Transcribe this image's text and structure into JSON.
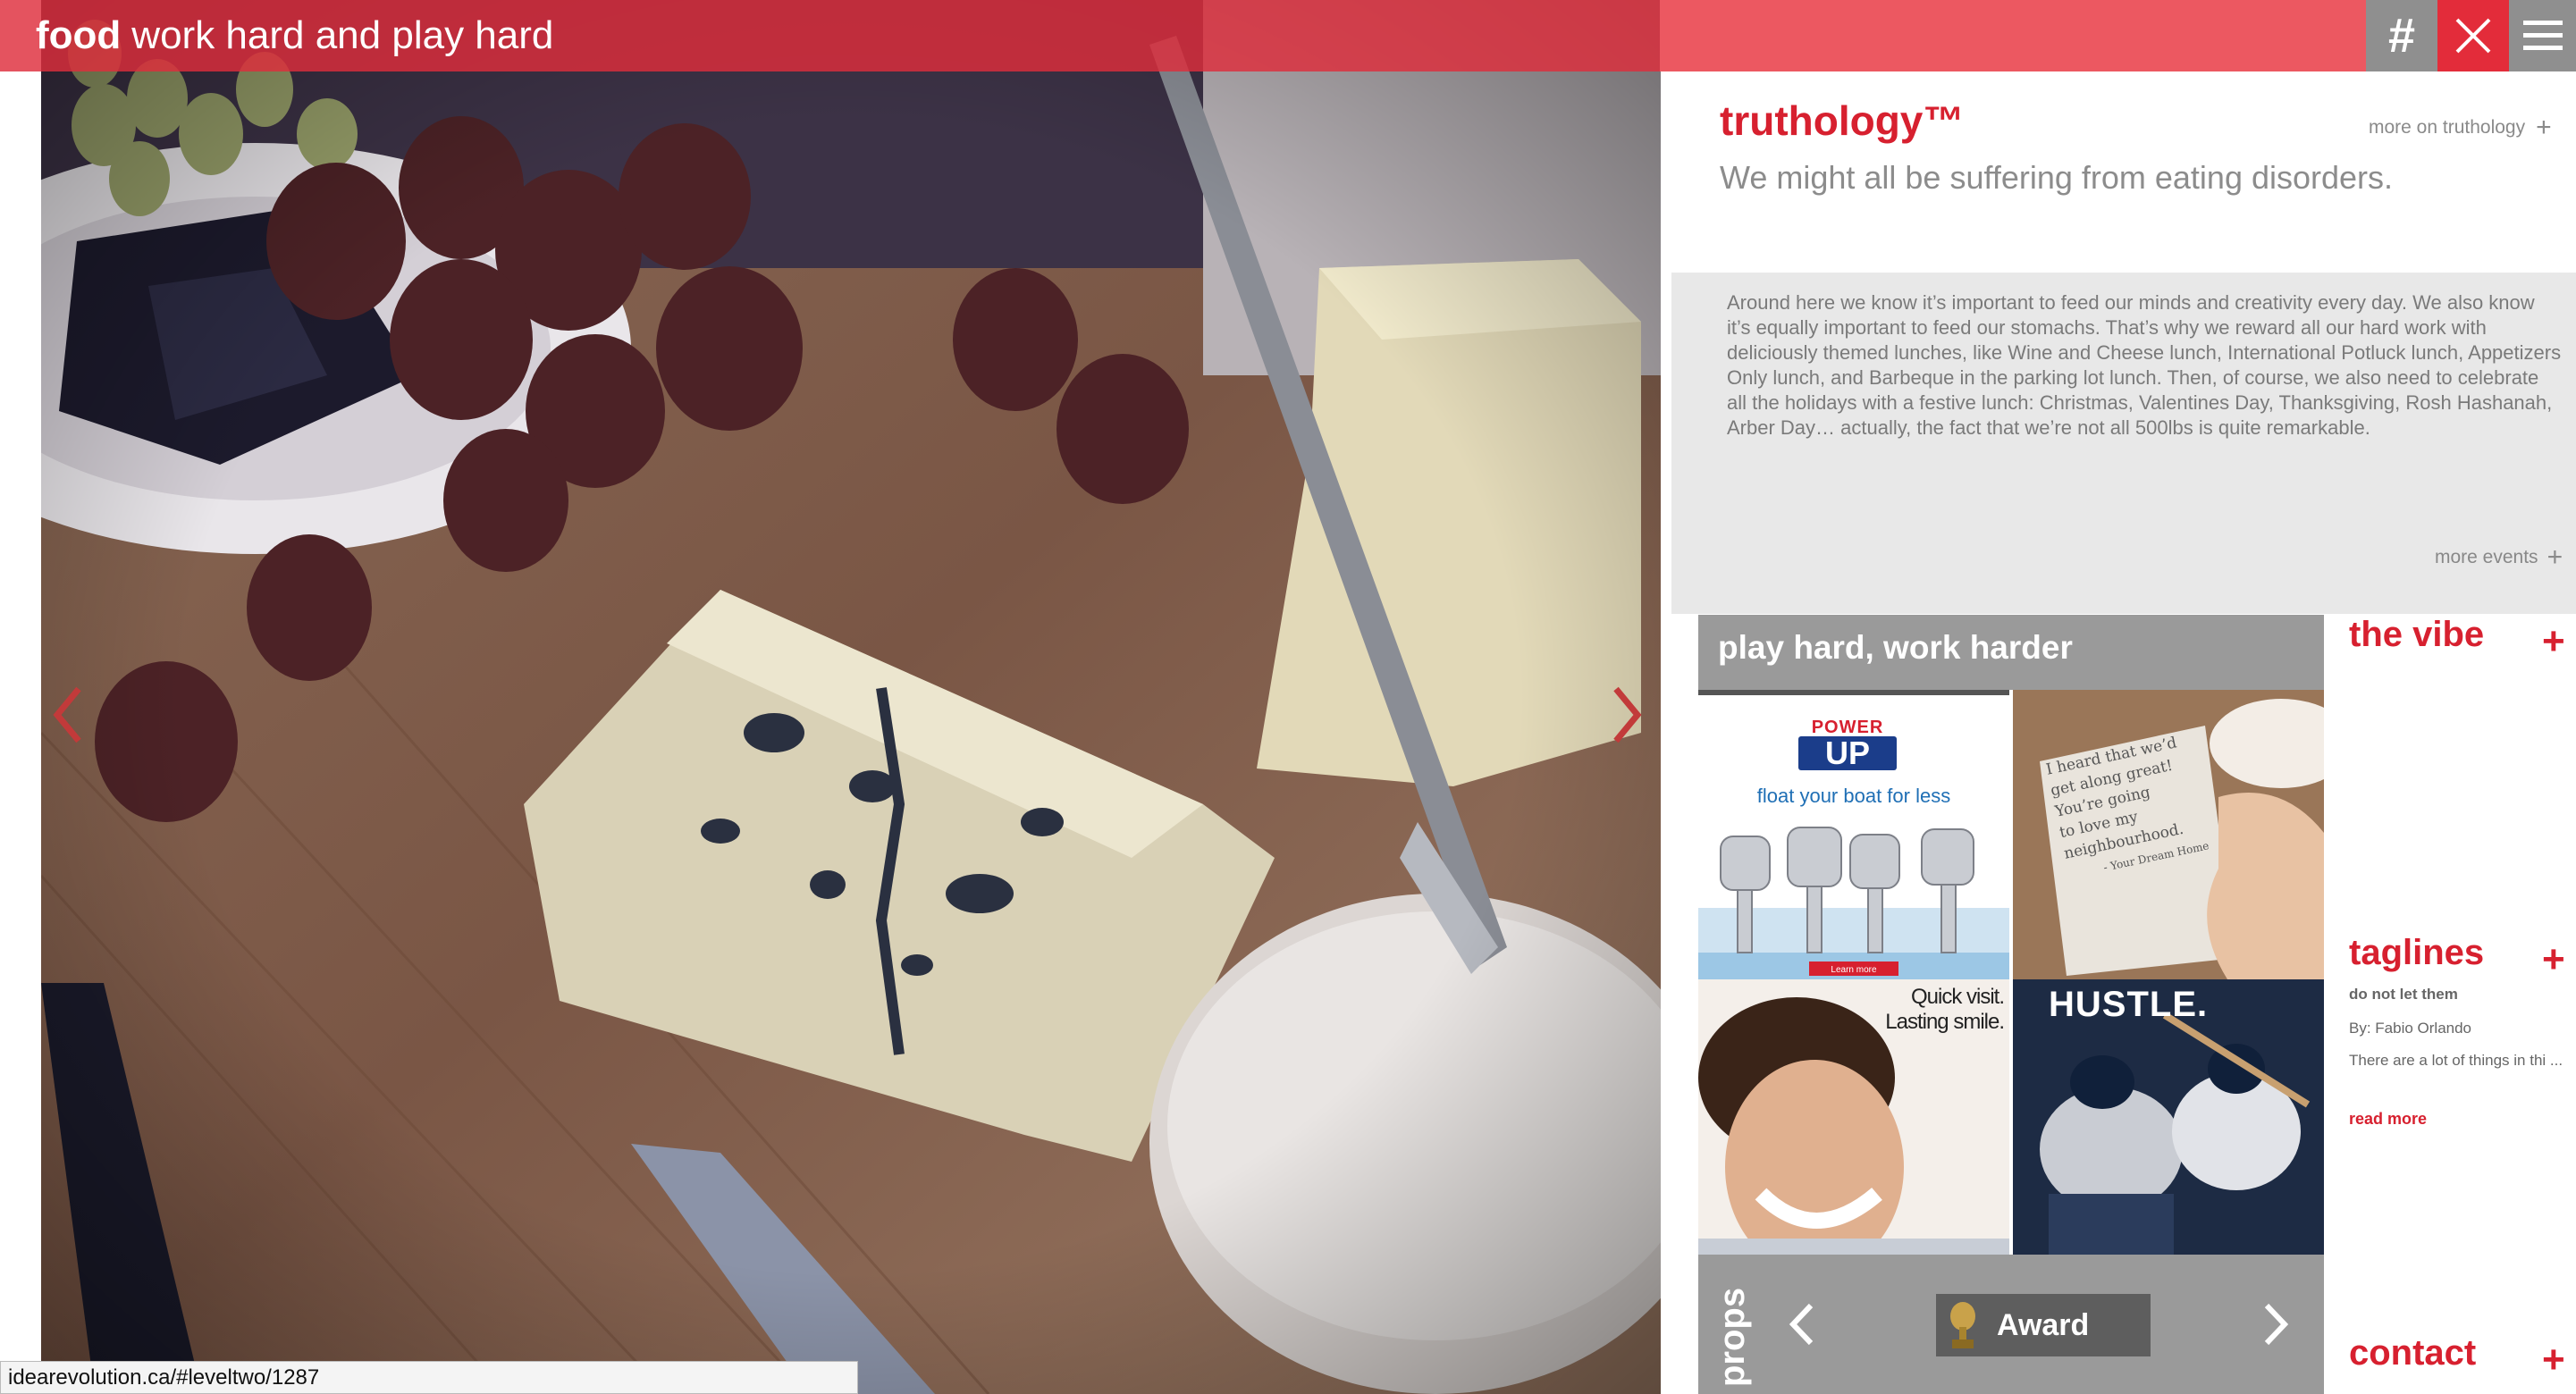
{
  "header": {
    "section": "food",
    "tagline": "work hard and play hard",
    "hash_label": "#"
  },
  "truthology": {
    "title": "truthology™",
    "more_link": "more on truthology",
    "subtitle": "We might all be suffering from eating disorders."
  },
  "events": {
    "body": "Around here we know it’s important to feed our minds and creativity every day. We also know it’s equally important to feed our stomachs. That’s why we reward all our hard work with deliciously themed lunches, like Wine and Cheese lunch, International Potluck lunch, Appetizers Only lunch, and Barbeque in the parking lot lunch. Then, of course, we also need to celebrate all the holidays with a festive lunch: Christmas, Valentines Day, Thanksgiving, Rosh Hashanah, Arber Day… actually, the fact that we’re not all 500lbs is quite remarkable.",
    "more_link": "more events"
  },
  "play": {
    "heading": "play hard, work harder",
    "tiles": {
      "power_logo_top": "POWER",
      "power_logo_main": "UP",
      "power_tagline": "float your boat for less",
      "power_cta": "Learn more",
      "note_lines": [
        "I heard that we’d",
        "get along great!",
        "You’re going",
        "to love my",
        "neighbourhood.",
        "- Your Dream Home"
      ],
      "smile_line1": "Quick visit.",
      "smile_line2": "Lasting smile.",
      "hustle": "HUSTLE."
    }
  },
  "props": {
    "label": "props",
    "award_label": "Award"
  },
  "sidebar": {
    "vibe_title": "the vibe",
    "taglines_title": "taglines",
    "tag_item_title": "do not let them",
    "tag_item_author": "By: Fabio Orlando",
    "tag_item_excerpt": "There are a lot of things in thi ...",
    "tag_read_more": "read more",
    "contact_title": "contact",
    "plus": "+"
  },
  "status_bar": {
    "url": "idearevolution.ca/#leveltwo/1287"
  },
  "colors": {
    "brand_red": "#d7202f",
    "topbar_red": "#e0303f",
    "panel_grey": "#e8e8e8",
    "tile_grey": "#9a9a9a"
  },
  "icons": {
    "hash": "hash-icon",
    "close": "close-icon",
    "menu": "hamburger-menu-icon",
    "hero_prev": "chevron-left-icon",
    "hero_next": "chevron-right-icon",
    "award": "trophy-icon"
  }
}
